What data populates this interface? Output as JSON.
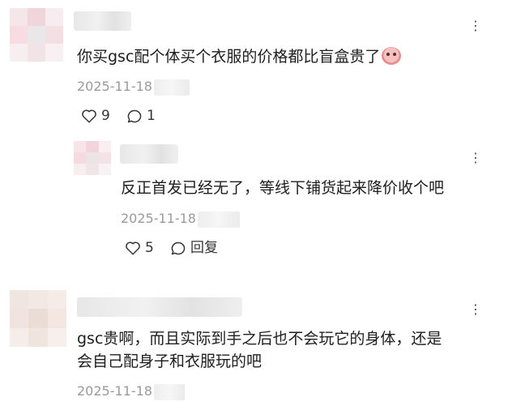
{
  "comments": [
    {
      "text": "你买gsc配个体买个衣服的价格都比盲盒贵了",
      "emoji": "crying-face-sticker",
      "timestamp": "2025-11-18",
      "likes": "9",
      "replies": "1"
    },
    {
      "text": "反正首发已经无了，等线下铺货起来降价收个吧",
      "timestamp": "2025-11-18",
      "likes": "5",
      "reply_label": "回复"
    },
    {
      "text_lines": [
        "gsc贵啊，而且实际到手之后也不会玩它的身体，还是",
        "会自己配身子和衣服玩的吧"
      ],
      "timestamp": "2025-11-18"
    }
  ],
  "more_label": "⋮",
  "colors": {
    "text": "#1e1e1e",
    "meta": "#9a9a9a",
    "icon": "#333333"
  }
}
